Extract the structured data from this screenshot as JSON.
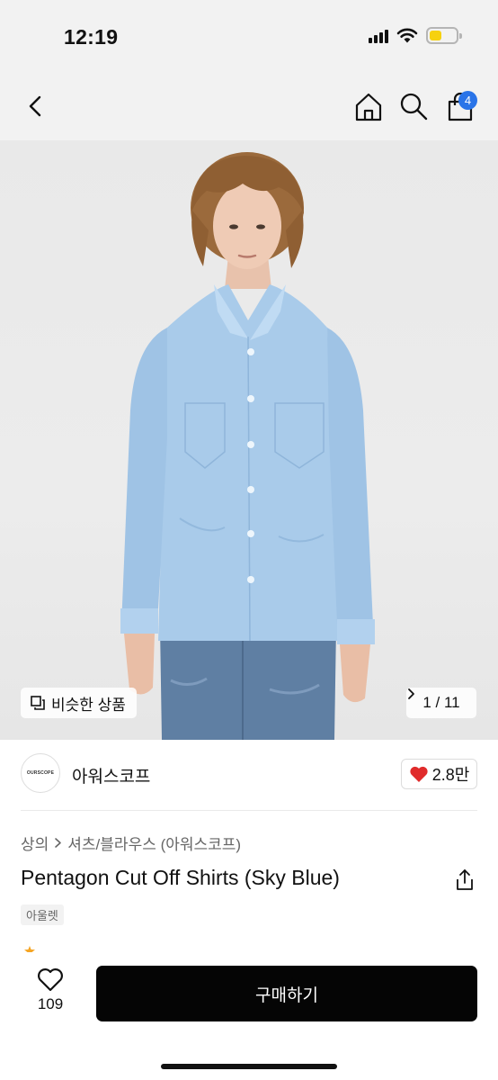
{
  "status_bar": {
    "time": "12:19",
    "battery_color": "#f6d10f"
  },
  "nav": {
    "back_icon": "chevron-left-icon",
    "home_icon": "home-icon",
    "search_icon": "search-icon",
    "bag_icon": "shopping-bag-icon",
    "bag_count": "4",
    "badge_color": "#2a74e8"
  },
  "gallery": {
    "similar_label": "비슷한 상품",
    "current": "1",
    "total": "11",
    "pager_text": "1 / 11"
  },
  "brand": {
    "logo_text": "OURSCOPE",
    "name": "아워스코프",
    "likes": "2.8만",
    "heart_color": "#e02b2b"
  },
  "product": {
    "breadcrumb": [
      "상의",
      "셔츠/블라우스 (아워스코프)"
    ],
    "title": "Pentagon Cut Off Shirts (Sky Blue)",
    "tag": "아울렛"
  },
  "bottom": {
    "wish_count": "109",
    "buy_label": "구매하기",
    "buy_color": "#050505"
  }
}
